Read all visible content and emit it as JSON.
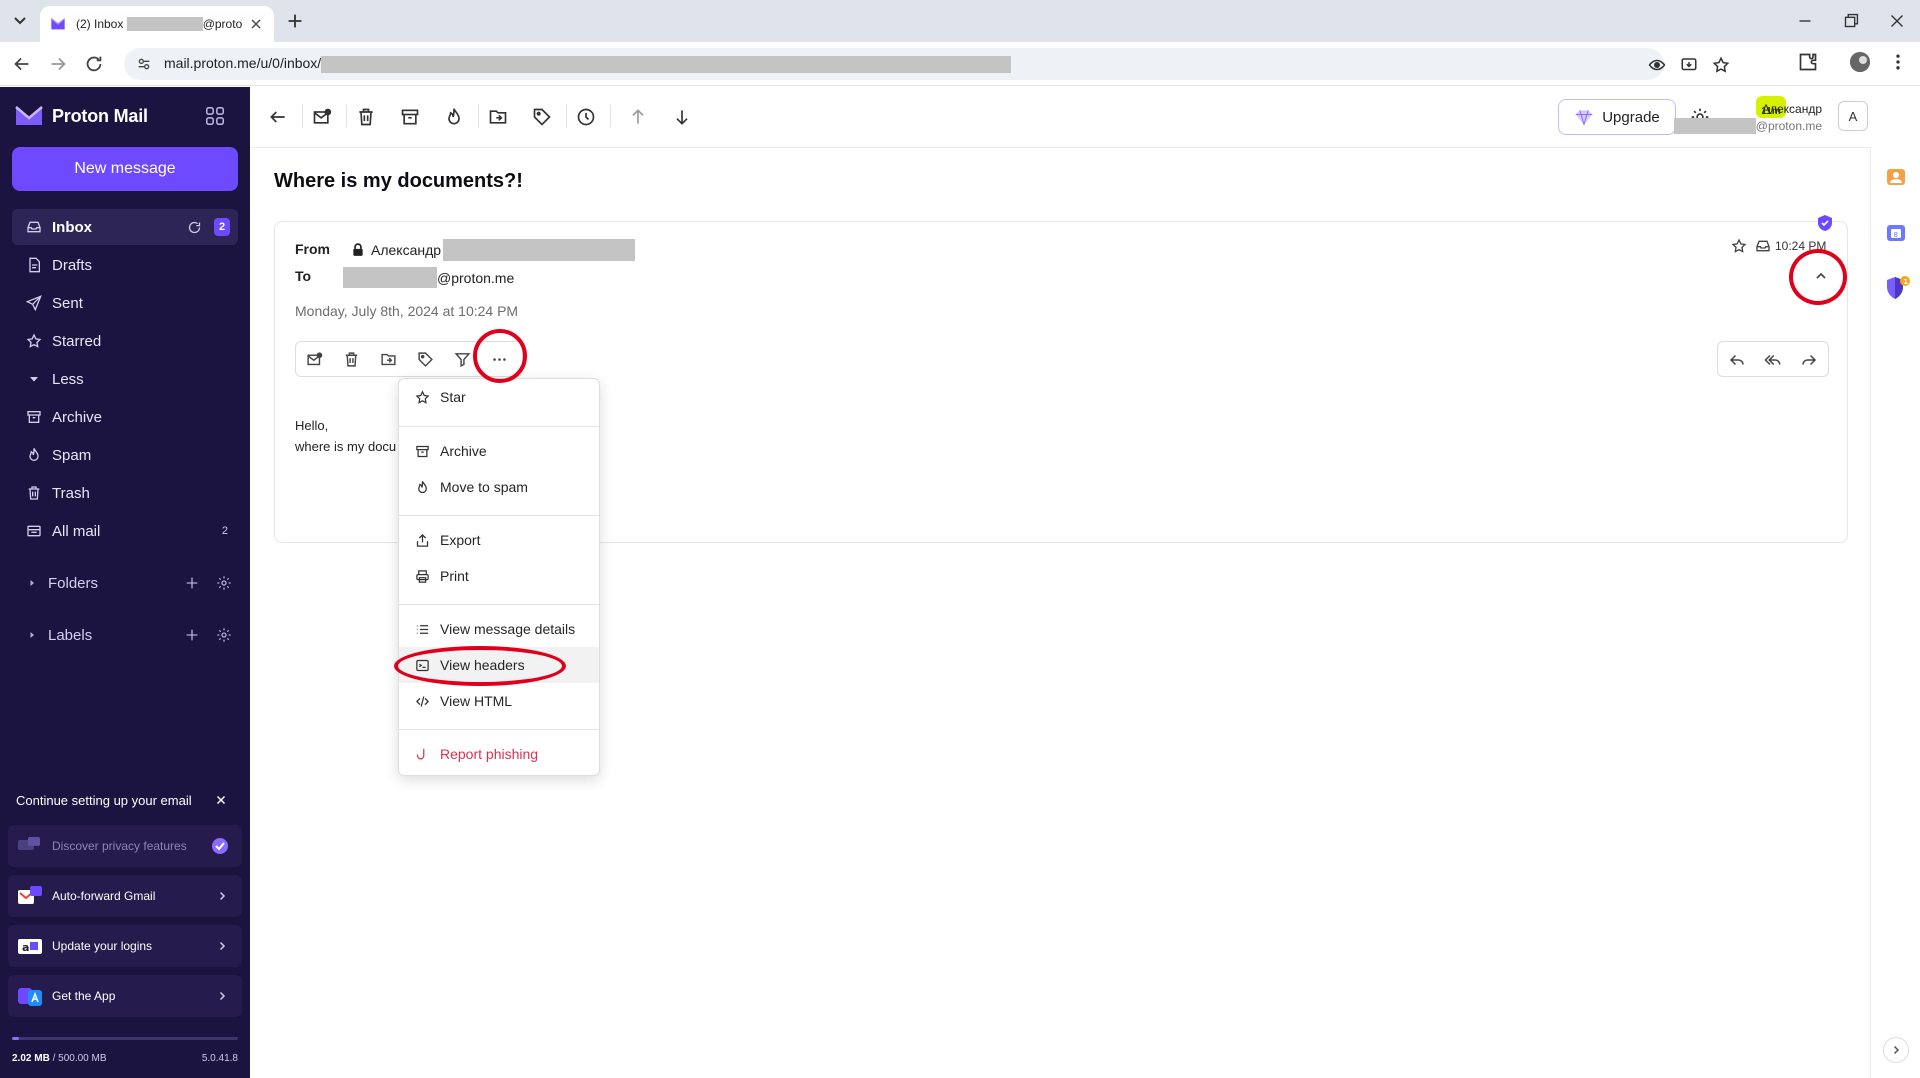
{
  "browser": {
    "tab_title": "(2) Inbox",
    "tab_title_suffix": "@proto",
    "url": "mail.proton.me/u/0/inbox/",
    "extension_badge": "11m"
  },
  "app": {
    "brand": "Proton Mail",
    "new_message": "New message",
    "nav": [
      {
        "label": "Inbox",
        "count": "2",
        "icon": "inbox-icon"
      },
      {
        "label": "Drafts",
        "icon": "draft-icon"
      },
      {
        "label": "Sent",
        "icon": "sent-icon"
      },
      {
        "label": "Starred",
        "icon": "star-icon"
      },
      {
        "label": "Less",
        "icon": "caret-down-icon"
      },
      {
        "label": "Archive",
        "icon": "archive-icon"
      },
      {
        "label": "Spam",
        "icon": "spam-icon"
      },
      {
        "label": "Trash",
        "icon": "trash-icon"
      },
      {
        "label": "All mail",
        "count": "2",
        "icon": "all-mail-icon"
      }
    ],
    "folders_label": "Folders",
    "labels_label": "Labels",
    "onboarding": {
      "title": "Continue setting up your email",
      "items": [
        {
          "label": "Discover privacy features",
          "done": true
        },
        {
          "label": "Auto-forward Gmail",
          "done": false
        },
        {
          "label": "Update your logins",
          "done": false
        },
        {
          "label": "Get the App",
          "done": false
        }
      ]
    },
    "storage": {
      "used": "2.02 MB",
      "total": "/ 500.00 MB",
      "fraction": 0.004
    },
    "version": "5.0.41.8"
  },
  "toolbar": {
    "upgrade": "Upgrade",
    "user_name": "Александр",
    "user_email_suffix": "@proton.me",
    "avatar_initial": "A"
  },
  "message": {
    "subject": "Where is my documents?!",
    "from_label": "From",
    "from_name": "Александр",
    "to_label": "To",
    "to_suffix": "@proton.me",
    "time": "10:24 PM",
    "date": "Monday, July 8th, 2024 at 10:24 PM",
    "body_line1": "Hello,",
    "body_line2": "where is my docu"
  },
  "more_menu": {
    "items": [
      {
        "label": "Star",
        "icon": "star-icon"
      },
      {
        "label": "Archive",
        "icon": "archive-icon"
      },
      {
        "label": "Move to spam",
        "icon": "spam-icon"
      },
      {
        "label": "Export",
        "icon": "export-icon"
      },
      {
        "label": "Print",
        "icon": "print-icon"
      },
      {
        "label": "View message details",
        "icon": "list-icon"
      },
      {
        "label": "View headers",
        "icon": "headers-icon"
      },
      {
        "label": "View HTML",
        "icon": "code-icon"
      },
      {
        "label": "Report phishing",
        "icon": "hook-icon"
      }
    ]
  },
  "colors": {
    "sidebar_bg": "#1b1340",
    "accent": "#6d4aff",
    "annotation_red": "#e0001b",
    "danger": "#dc3251"
  }
}
